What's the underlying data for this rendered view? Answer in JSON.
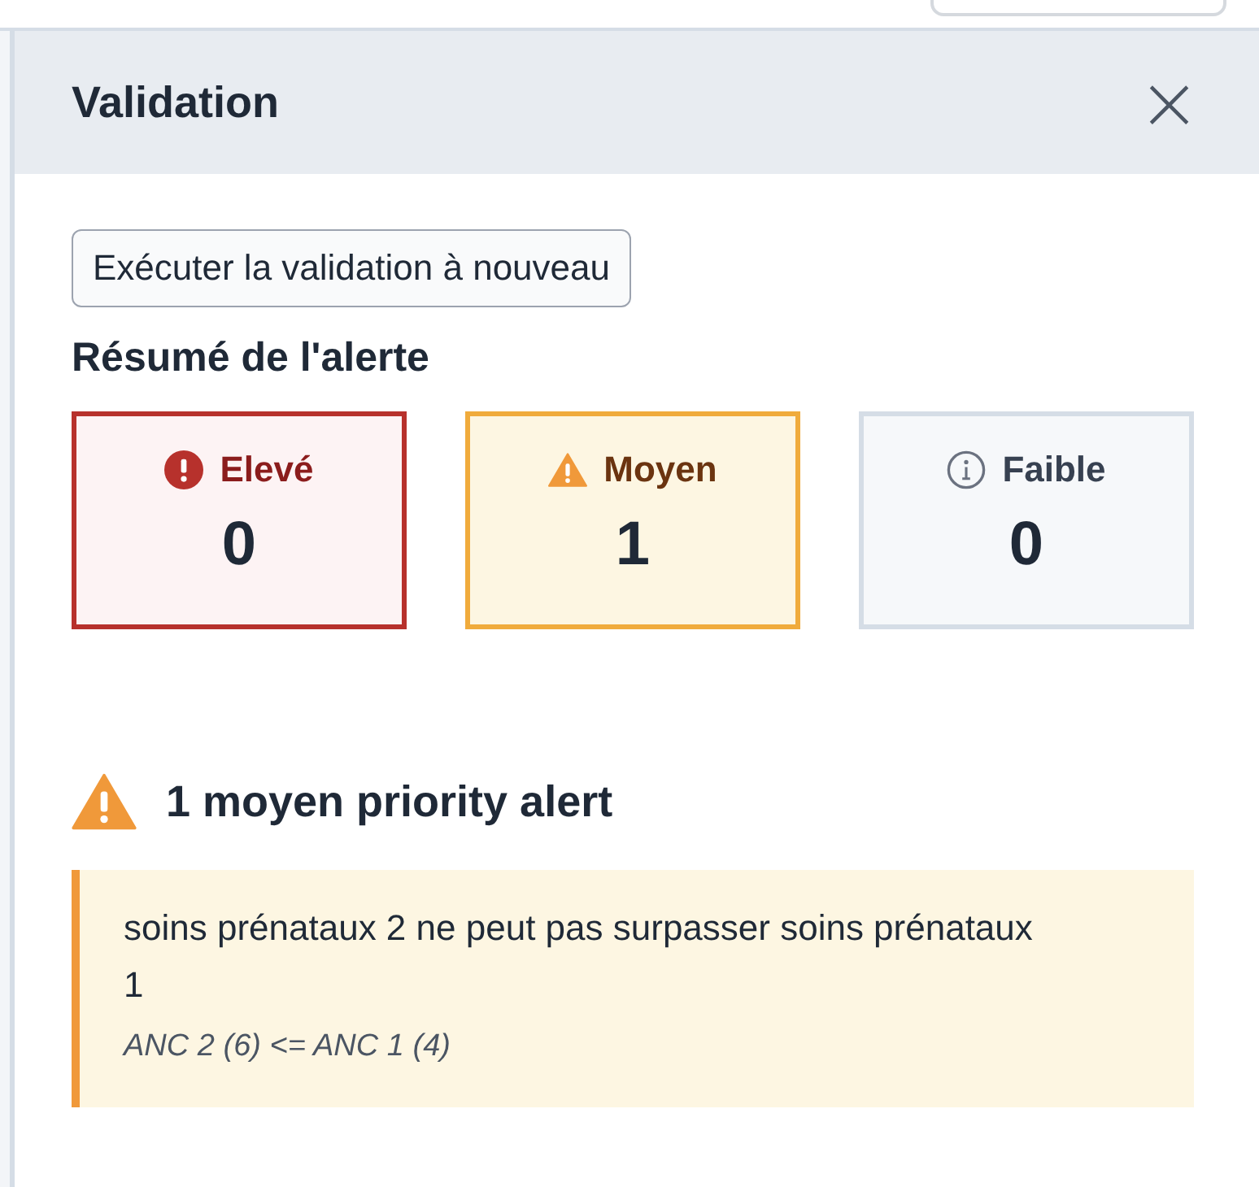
{
  "panel": {
    "title": "Validation",
    "close_glyph": "×"
  },
  "rerun_button": "Exécuter la validation à nouveau",
  "summary": {
    "title": "Résumé de l'alerte",
    "cards": [
      {
        "kind": "high",
        "label": "Elevé",
        "count": "0"
      },
      {
        "kind": "medium",
        "label": "Moyen",
        "count": "1"
      },
      {
        "kind": "low",
        "label": "Faible",
        "count": "0"
      }
    ]
  },
  "alert_group": {
    "kind": "medium",
    "heading": "1 moyen priority alert",
    "alerts": [
      {
        "message": "soins prénataux 2 ne peut pas surpasser soins prénataux 1",
        "detail": "ANC 2 (6) <= ANC 1 (4)"
      }
    ]
  }
}
